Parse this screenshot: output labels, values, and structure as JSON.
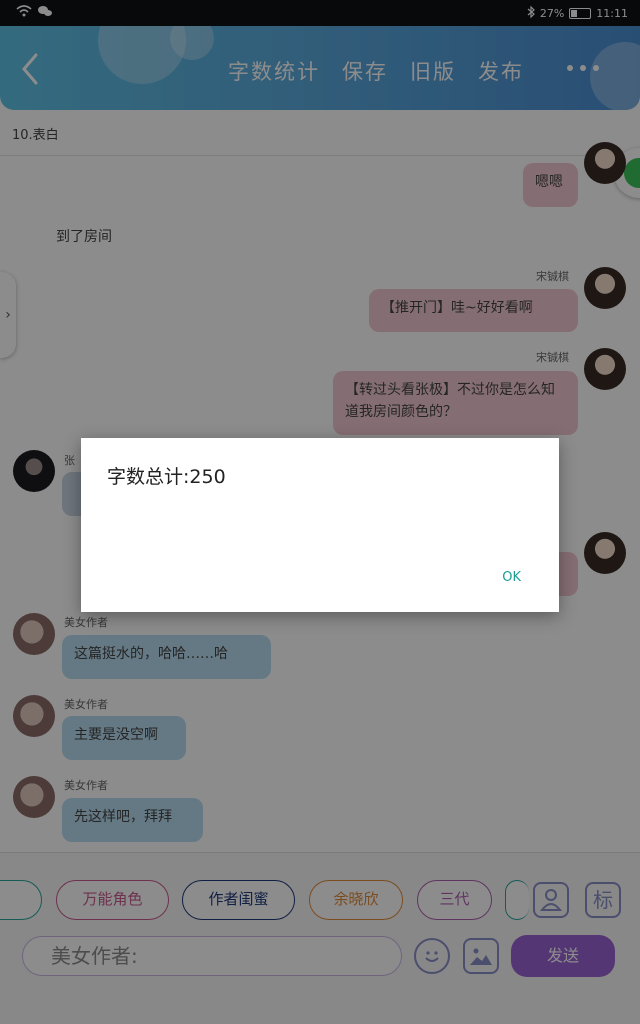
{
  "status_bar": {
    "battery_text": "27%",
    "time": "11:11"
  },
  "header": {
    "back_icon": "chevron-left-icon",
    "actions": [
      "字数统计",
      "保存",
      "旧版",
      "发布"
    ],
    "more_icon": "more-dots-icon"
  },
  "chat": {
    "title": "10.表白"
  },
  "messages": [
    {
      "side": "right",
      "sender": "",
      "text": "嗯嗯"
    },
    {
      "side": "plain",
      "sender": "",
      "text": "到了房间"
    },
    {
      "side": "right",
      "sender": "宋铖棋",
      "text": "【推开门】哇~好好看啊"
    },
    {
      "side": "right",
      "sender": "宋铖棋",
      "text": "【转过头看张极】不过你是怎么知道我房间颜色的？"
    },
    {
      "side": "left",
      "sender": "张",
      "text": ""
    },
    {
      "side": "left",
      "sender": "美女作者",
      "text": "这篇挺水的，哈哈……哈"
    },
    {
      "side": "left",
      "sender": "美女作者",
      "text": "主要是没空啊"
    },
    {
      "side": "left",
      "sender": "美女作者",
      "text": "先这样吧，拜拜"
    }
  ],
  "characters": [
    {
      "label": "万能角色",
      "color": "#c85a8f"
    },
    {
      "label": "作者闺蜜",
      "color": "#1f3a7a"
    },
    {
      "label": "余晓欣",
      "color": "#e08a3a"
    },
    {
      "label": "三代",
      "color": "#b05fb0"
    }
  ],
  "tools": {
    "profile_icon": "person-icon",
    "tag_label": "标"
  },
  "composer": {
    "value": "美女作者:",
    "send_label": "发送",
    "emoji_icon": "emoji-icon",
    "image_icon": "image-icon"
  },
  "dialog": {
    "message": "字数总计:250",
    "ok_label": "OK"
  },
  "colors": {
    "header_start": "#5fc2e6",
    "header_end": "#4c8fd4",
    "send_button": "#9b63d6",
    "ok_text": "#1a9e96"
  }
}
